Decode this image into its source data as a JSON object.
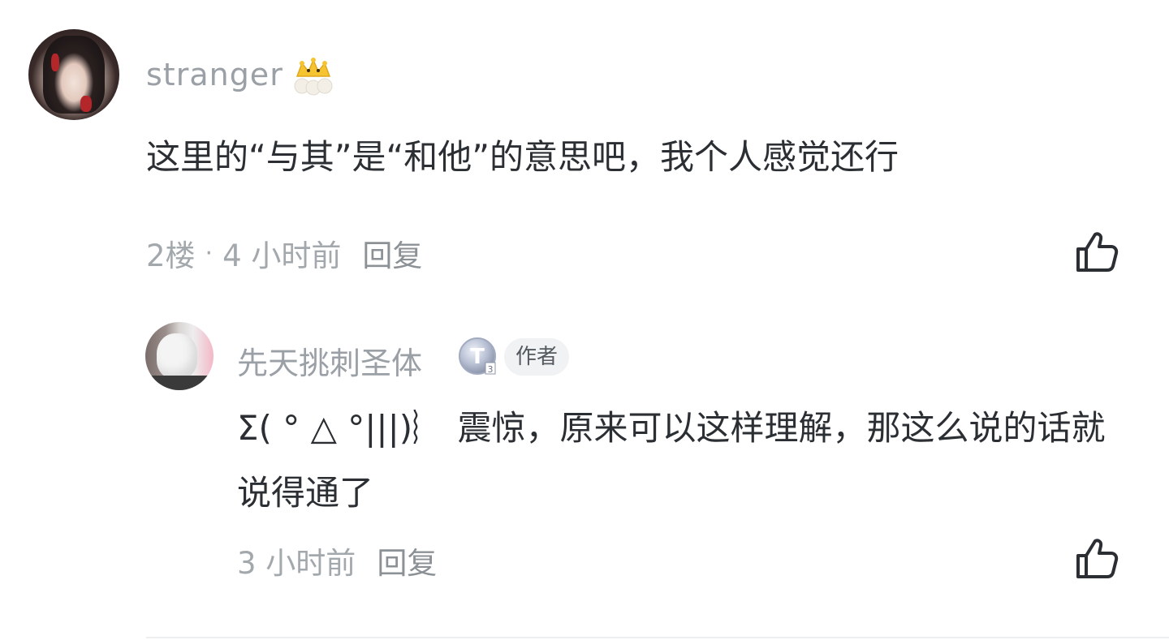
{
  "comment": {
    "username": "stranger",
    "text": "这里的“与其”是“和他”的意思吧，我个人感觉还行",
    "floor": "2楼",
    "separator": "·",
    "time": "4 小时前",
    "reply_label": "回复"
  },
  "reply": {
    "username": "先天挑刺圣体",
    "level_icon": "level-badge-T3",
    "author_tag": "作者",
    "text": "Σ( ° △ °|||)︴ 震惊，原来可以这样理解，那这么说的话就说得通了",
    "time": "3 小时前",
    "reply_label": "回复"
  },
  "icons": {
    "crown": "crown-icon",
    "like": "thumbs-up-icon"
  },
  "colors": {
    "username": "#9aa0a6",
    "text": "#2b2f33",
    "meta": "#a3a8ad",
    "tag_bg": "#f1f2f3"
  }
}
